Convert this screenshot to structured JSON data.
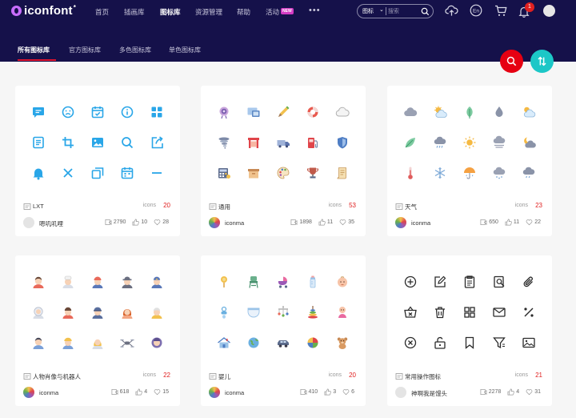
{
  "header": {
    "brand": "iconfont",
    "brand_mark": "*",
    "nav": [
      "首页",
      "插画库",
      "图标库",
      "资源管理",
      "帮助",
      "活动"
    ],
    "nav_active": "图标库",
    "new_badge": "NEW",
    "more": "•••",
    "search_category": "图标",
    "search_placeholder": "搜索",
    "notification_count": "1",
    "icons": [
      "upload-icon",
      "language-icon",
      "cart-icon",
      "bell-icon",
      "user-avatar"
    ]
  },
  "subnav": {
    "tabs": [
      "所有图标库",
      "官方图标库",
      "多色图标库",
      "单色图标库"
    ],
    "active_tab": "所有图标库"
  },
  "count_label": "icons",
  "cards": [
    {
      "title": "LXT",
      "count": "20",
      "author": "嗯叽叽哩",
      "views": "2790",
      "likes": "10",
      "favorites": "28",
      "style": "blue line icons"
    },
    {
      "title": "通用",
      "count": "53",
      "author": "iconma",
      "views": "1898",
      "likes": "11",
      "favorites": "35",
      "style": "multicolor"
    },
    {
      "title": "天气",
      "count": "23",
      "author": "iconma",
      "views": "650",
      "likes": "11",
      "favorites": "22",
      "style": "multicolor weather"
    },
    {
      "title": "人物肖像与机器人",
      "count": "22",
      "author": "iconma",
      "views": "618",
      "likes": "4",
      "favorites": "15",
      "style": "multicolor avatars"
    },
    {
      "title": "婴儿",
      "count": "20",
      "author": "iconma",
      "views": "410",
      "likes": "3",
      "favorites": "6",
      "style": "multicolor baby"
    },
    {
      "title": "常用操作图标",
      "count": "21",
      "author": "神啊我是馒头",
      "views": "2278",
      "likes": "4",
      "favorites": "31",
      "style": "black line icons"
    }
  ],
  "colors": {
    "topbar": "#15114a",
    "accent_red": "#e60012",
    "accent_teal": "#1cc7c7",
    "icon_blue": "#29a6e8",
    "count_red": "#e02020"
  }
}
